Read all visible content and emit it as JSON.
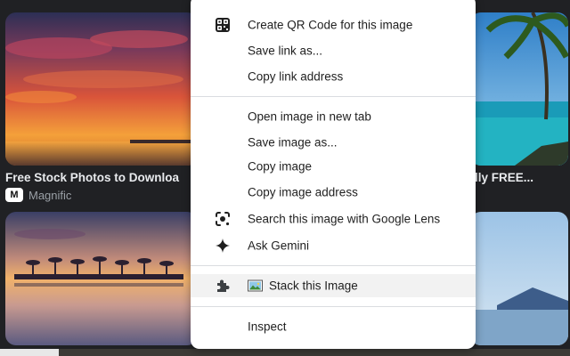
{
  "results": {
    "left_caption": "Free Stock Photos to Downloa",
    "left_source": "Magnific",
    "left_logo": "M",
    "right_caption": "tally FREE..."
  },
  "context_menu": {
    "items": [
      {
        "icon": "qr-code-icon",
        "label": "Create QR Code for this image"
      },
      {
        "icon": "",
        "label": "Save link as..."
      },
      {
        "icon": "",
        "label": "Copy link address"
      },
      {
        "icon": "",
        "label": "Open image in new tab"
      },
      {
        "icon": "",
        "label": "Save image as..."
      },
      {
        "icon": "",
        "label": "Copy image"
      },
      {
        "icon": "",
        "label": "Copy image address"
      },
      {
        "icon": "google-lens-icon",
        "label": "Search this image with Google Lens"
      },
      {
        "icon": "gemini-sparkle-icon",
        "label": "Ask Gemini"
      },
      {
        "icon": "puzzle-extension-icon",
        "label": "Stack this Image",
        "highlighted": true
      },
      {
        "icon": "",
        "label": "Inspect"
      }
    ]
  },
  "colors": {
    "page_background": "#202124",
    "menu_background": "#ffffff",
    "menu_text": "#1f1f1f",
    "hover_background": "#f2f2f2",
    "caption_text": "#e8eaed",
    "source_text": "#9aa0a6"
  }
}
